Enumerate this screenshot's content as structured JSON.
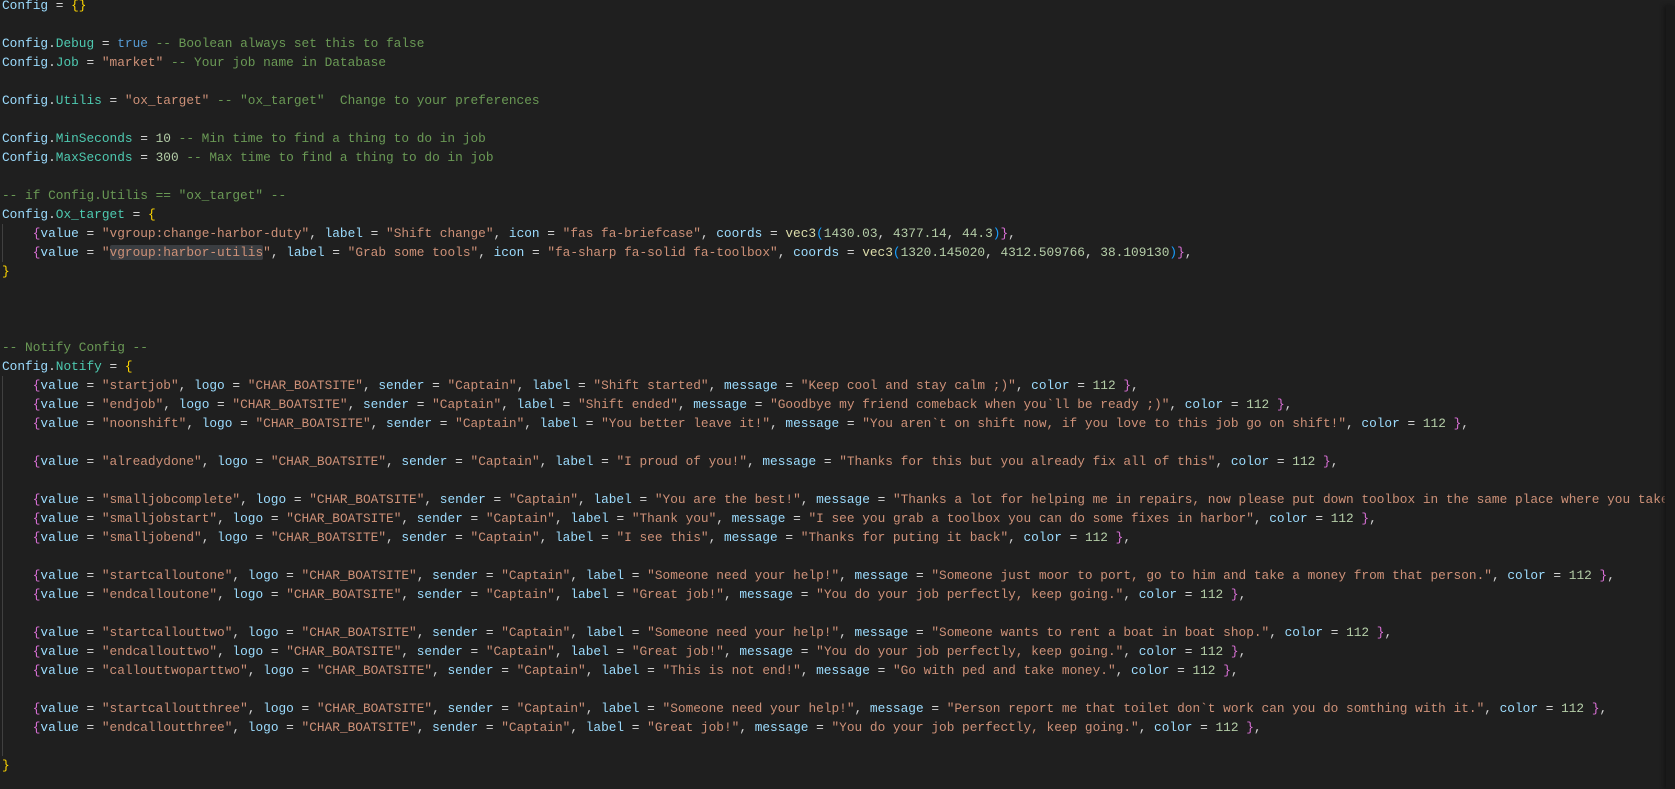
{
  "theme": {
    "background": "#1f1f1f",
    "variable": "#9cdcfe",
    "property": "#4ec9b0",
    "string": "#ce9178",
    "number": "#b5cea8",
    "comment": "#6a9955",
    "keyword": "#569cd6"
  },
  "lines": [
    {
      "t": [
        [
          "o",
          "  "
        ]
      ]
    },
    {
      "t": [
        [
          "v",
          "Config"
        ],
        [
          "o",
          " = "
        ],
        [
          "b1",
          "{}"
        ]
      ]
    },
    null,
    {
      "t": [
        [
          "v",
          "Config"
        ],
        [
          "o",
          "."
        ],
        [
          "p",
          "Debug"
        ],
        [
          "o",
          " = "
        ],
        [
          "k",
          "true"
        ],
        [
          "c",
          " -- Boolean always set this to false"
        ]
      ]
    },
    {
      "t": [
        [
          "v",
          "Config"
        ],
        [
          "o",
          "."
        ],
        [
          "p",
          "Job"
        ],
        [
          "o",
          " = "
        ],
        [
          "s",
          "\"market\""
        ],
        [
          "c",
          " -- Your job name in Database"
        ]
      ]
    },
    null,
    {
      "t": [
        [
          "v",
          "Config"
        ],
        [
          "o",
          "."
        ],
        [
          "p",
          "Utilis"
        ],
        [
          "o",
          " = "
        ],
        [
          "s",
          "\"ox_target\""
        ],
        [
          "c",
          " -- \"ox_target\"  Change to your preferences"
        ]
      ]
    },
    null,
    {
      "t": [
        [
          "v",
          "Config"
        ],
        [
          "o",
          "."
        ],
        [
          "p",
          "MinSeconds"
        ],
        [
          "o",
          " = "
        ],
        [
          "n",
          "10"
        ],
        [
          "c",
          " -- Min time to find a thing to do in job"
        ]
      ]
    },
    {
      "t": [
        [
          "v",
          "Config"
        ],
        [
          "o",
          "."
        ],
        [
          "p",
          "MaxSeconds"
        ],
        [
          "o",
          " = "
        ],
        [
          "n",
          "300"
        ],
        [
          "c",
          " -- Max time to find a thing to do in job"
        ]
      ]
    },
    null,
    {
      "t": [
        [
          "c",
          "-- if Config.Utilis == \"ox_target\" --"
        ]
      ]
    },
    {
      "t": [
        [
          "v",
          "Config"
        ],
        [
          "o",
          "."
        ],
        [
          "p",
          "Ox_target"
        ],
        [
          "o",
          " = "
        ],
        [
          "b1",
          "{"
        ]
      ]
    },
    {
      "target": {
        "value": "vgroup:change-harbor-duty",
        "label": "Shift change",
        "icon": "fas fa-briefcase",
        "coords": [
          "1430.03",
          "4377.14",
          "44.3"
        ]
      }
    },
    {
      "target": {
        "value": "vgroup:harbor-utilis",
        "label": "Grab some tools",
        "icon": "fa-sharp fa-solid fa-toolbox",
        "coords": [
          "1320.145020",
          "4312.509766",
          "38.109130"
        ],
        "highlight": true
      }
    },
    {
      "t": [
        [
          "b1",
          "}"
        ]
      ]
    },
    null,
    null,
    null,
    {
      "t": [
        [
          "c",
          "-- Notify Config --"
        ]
      ]
    },
    {
      "t": [
        [
          "v",
          "Config"
        ],
        [
          "o",
          "."
        ],
        [
          "p",
          "Notify"
        ],
        [
          "o",
          " = "
        ],
        [
          "b1",
          "{"
        ]
      ]
    },
    {
      "notify": {
        "value": "startjob",
        "logo": "CHAR_BOATSITE",
        "sender": "Captain",
        "label": "Shift started",
        "message": "Keep cool and stay calm ;)",
        "color": "112"
      }
    },
    {
      "notify": {
        "value": "endjob",
        "logo": "CHAR_BOATSITE",
        "sender": "Captain",
        "label": "Shift ended",
        "message": "Goodbye my friend comeback when you`ll be ready ;)",
        "color": "112"
      }
    },
    {
      "notify": {
        "value": "noonshift",
        "logo": "CHAR_BOATSITE",
        "sender": "Captain",
        "label": "You better leave it!",
        "message": "You aren`t on shift now, if you love to this job go on shift!",
        "color": "112"
      }
    },
    {
      "guide": true
    },
    {
      "notify": {
        "value": "alreadydone",
        "logo": "CHAR_BOATSITE",
        "sender": "Captain",
        "label": "I proud of you!",
        "message": "Thanks for this but you already fix all of this",
        "color": "112"
      }
    },
    {
      "guide": true
    },
    {
      "notify": {
        "value": "smalljobcomplete",
        "logo": "CHAR_BOATSITE",
        "sender": "Captain",
        "label": "You are the best!",
        "message": "Thanks a lot for helping me in repairs, now please put down toolbox in the same place where you take",
        "truncated": true
      }
    },
    {
      "notify": {
        "value": "smalljobstart",
        "logo": "CHAR_BOATSITE",
        "sender": "Captain",
        "label": "Thank you",
        "message": "I see you grab a toolbox you can do some fixes in harbor",
        "color": "112"
      }
    },
    {
      "notify": {
        "value": "smalljobend",
        "logo": "CHAR_BOATSITE",
        "sender": "Captain",
        "label": "I see this",
        "message": "Thanks for puting it back",
        "color": "112"
      }
    },
    {
      "guide": true
    },
    {
      "notify": {
        "value": "startcalloutone",
        "logo": "CHAR_BOATSITE",
        "sender": "Captain",
        "label": "Someone need your help!",
        "message": "Someone just moor to port, go to him and take a money from that person.",
        "color": "112"
      }
    },
    {
      "notify": {
        "value": "endcalloutone",
        "logo": "CHAR_BOATSITE",
        "sender": "Captain",
        "label": "Great job!",
        "message": "You do your job perfectly, keep going.",
        "color": "112"
      }
    },
    {
      "guide": true
    },
    {
      "notify": {
        "value": "startcallouttwo",
        "logo": "CHAR_BOATSITE",
        "sender": "Captain",
        "label": "Someone need your help!",
        "message": "Someone wants to rent a boat in boat shop.",
        "color": "112"
      }
    },
    {
      "notify": {
        "value": "endcallouttwo",
        "logo": "CHAR_BOATSITE",
        "sender": "Captain",
        "label": "Great job!",
        "message": "You do your job perfectly, keep going.",
        "color": "112"
      }
    },
    {
      "notify": {
        "value": "callouttwoparttwo",
        "logo": "CHAR_BOATSITE",
        "sender": "Captain",
        "label": "This is not end!",
        "message": "Go with ped and take money.",
        "color": "112"
      }
    },
    {
      "guide": true
    },
    {
      "notify": {
        "value": "startcalloutthree",
        "logo": "CHAR_BOATSITE",
        "sender": "Captain",
        "label": "Someone need your help!",
        "message": "Person report me that toilet don`t work can you do somthing with it.",
        "color": "112"
      }
    },
    {
      "notify": {
        "value": "endcalloutthree",
        "logo": "CHAR_BOATSITE",
        "sender": "Captain",
        "label": "Great job!",
        "message": "You do your job perfectly, keep going.",
        "color": "112"
      }
    },
    {
      "guide": true
    },
    {
      "t": [
        [
          "b1",
          "}"
        ]
      ]
    }
  ]
}
